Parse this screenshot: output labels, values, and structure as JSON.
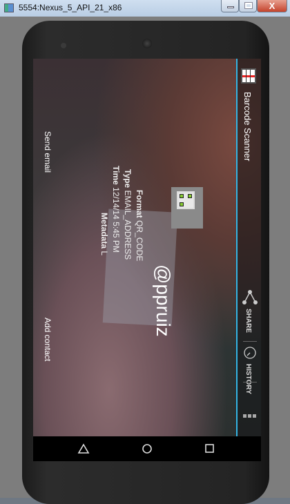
{
  "window": {
    "title": "5554:Nexus_5_API_21_x86",
    "close_label": "X"
  },
  "app": {
    "title": "Barcode Scanner",
    "accent": "#33b5e5"
  },
  "actions": {
    "share": "SHARE",
    "history": "HISTORY"
  },
  "result": {
    "format_label": "Format",
    "format_value": "QR_CODE",
    "type_label": "Type",
    "type_value": "EMAIL_ADDRESS",
    "time_label": "Time",
    "time_value": "12/14/14 5:45 PM",
    "metadata_label": "Metadata",
    "metadata_value": "L",
    "contents": "@ppruiz"
  },
  "buttons": {
    "send_email": "Send email",
    "add_contact": "Add contact"
  }
}
